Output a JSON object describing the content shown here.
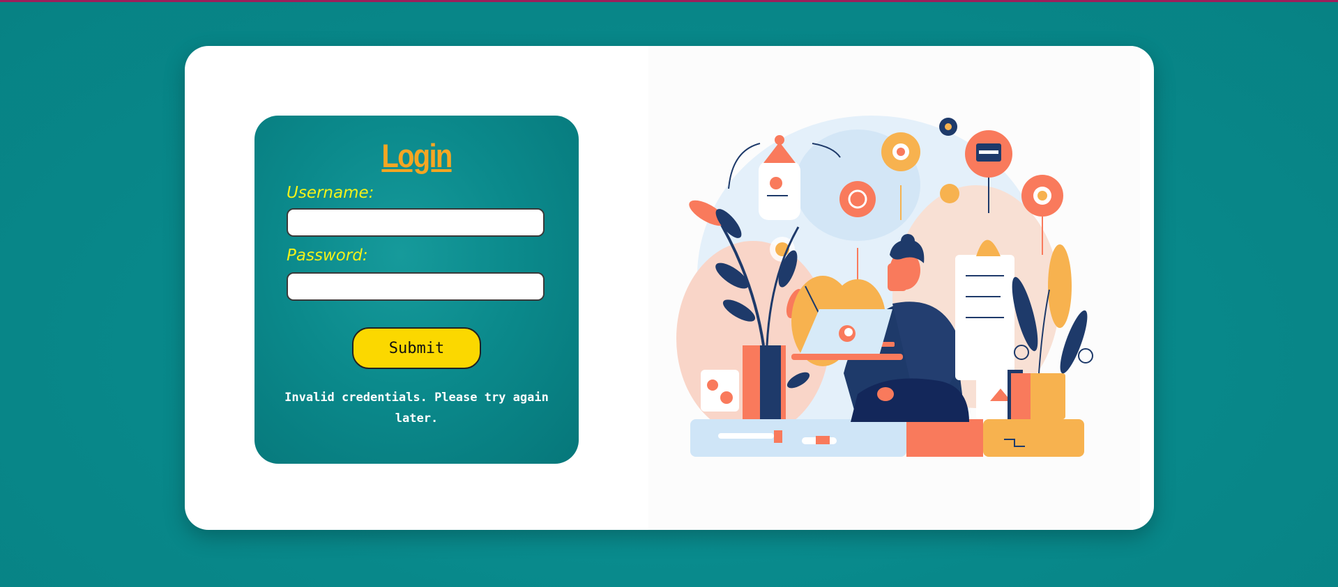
{
  "form": {
    "title": "Login",
    "username_label": "Username:",
    "username_value": "",
    "password_label": "Password:",
    "password_value": "",
    "submit_label": "Submit",
    "error_message": "Invalid credentials. Please try again later."
  },
  "colors": {
    "page_background": "#08888a",
    "accent_bar": "#9c1f5b",
    "title": "#f5a623",
    "label": "#f2f21a",
    "button": "#fbd800"
  },
  "illustration": {
    "subject": "person-working-on-laptop-illustration"
  }
}
